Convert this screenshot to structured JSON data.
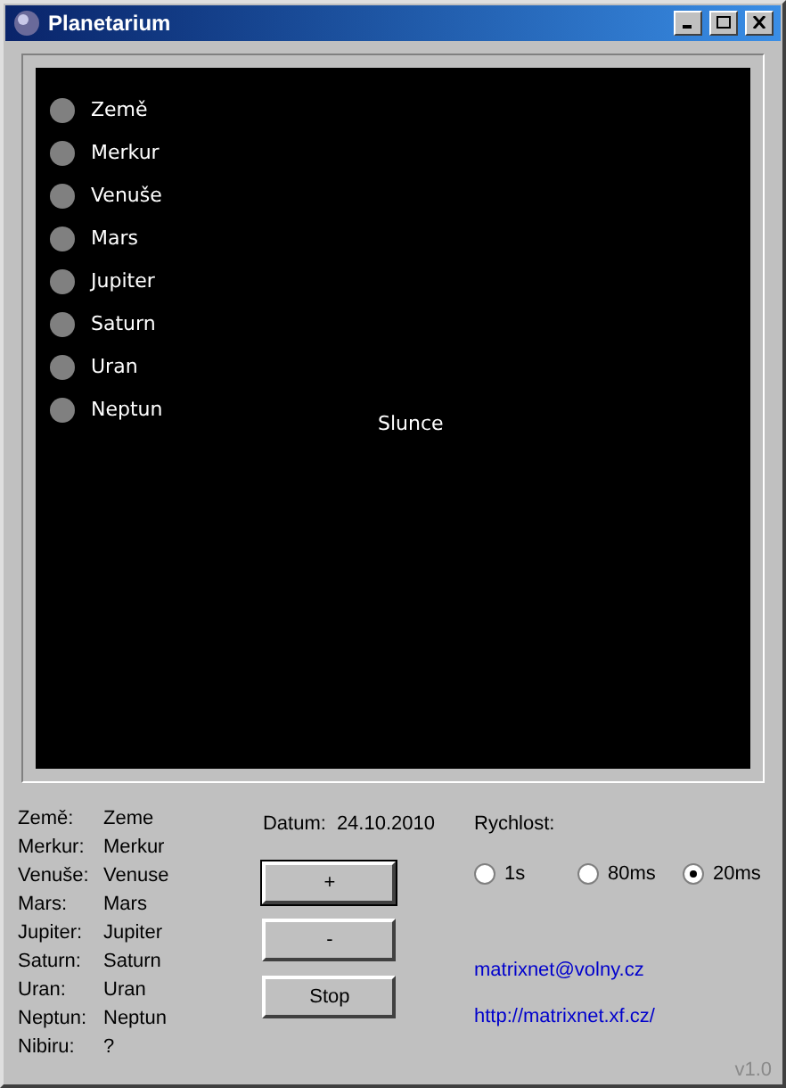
{
  "window": {
    "title": "Planetarium"
  },
  "canvas": {
    "planets": [
      "Země",
      "Merkur",
      "Venuše",
      "Mars",
      "Jupiter",
      "Saturn",
      "Uran",
      "Neptun"
    ],
    "sun": "Slunce"
  },
  "positions": [
    {
      "label": "Země:",
      "value": "Zeme"
    },
    {
      "label": "Merkur:",
      "value": "Merkur"
    },
    {
      "label": "Venuše:",
      "value": "Venuse"
    },
    {
      "label": "Mars:",
      "value": "Mars"
    },
    {
      "label": "Jupiter:",
      "value": "Jupiter"
    },
    {
      "label": "Saturn:",
      "value": "Saturn"
    },
    {
      "label": "Uran:",
      "value": "Uran"
    },
    {
      "label": "Neptun:",
      "value": "Neptun"
    },
    {
      "label": "Nibiru:",
      "value": "?"
    }
  ],
  "date": {
    "label": "Datum:",
    "value": "24.10.2010"
  },
  "buttons": [
    "+",
    "-",
    "Stop"
  ],
  "speed": {
    "label": "Rychlost:",
    "options": [
      {
        "label": "1s",
        "selected": false
      },
      {
        "label": "80ms",
        "selected": false
      },
      {
        "label": "20ms",
        "selected": true
      }
    ]
  },
  "links": [
    "matrixnet@volny.cz",
    "http://matrixnet.xf.cz/"
  ],
  "version": "v1.0"
}
